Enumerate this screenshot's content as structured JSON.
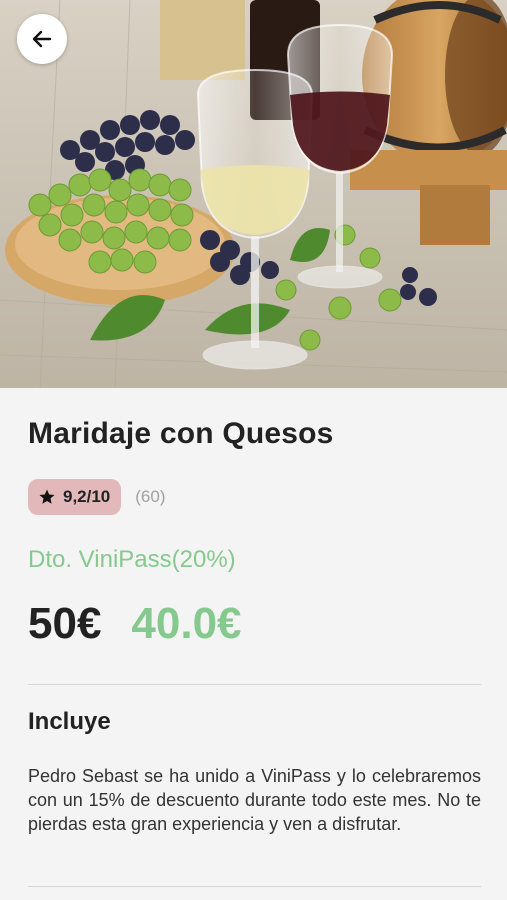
{
  "header": {
    "back_icon": "arrow-left-icon",
    "hero_image_subject": "wine-glasses-grapes-barrel"
  },
  "product": {
    "title": "Maridaje con Quesos",
    "rating": {
      "icon": "star-icon",
      "value": "9,2/10",
      "count": "(60)",
      "badge_color": "#e2b8bb"
    },
    "discount_label": "Dto. ViniPass(20%)",
    "price_original": "50€",
    "price_discounted": "40.0€",
    "accent_color": "#86c98e"
  },
  "includes": {
    "title": "Incluye",
    "description": "Pedro Sebast se ha unido a ViniPass y lo celebraremos con un 15% de descuento durante todo este mes. No te pierdas esta gran experiencia y ven a disfrutar."
  }
}
